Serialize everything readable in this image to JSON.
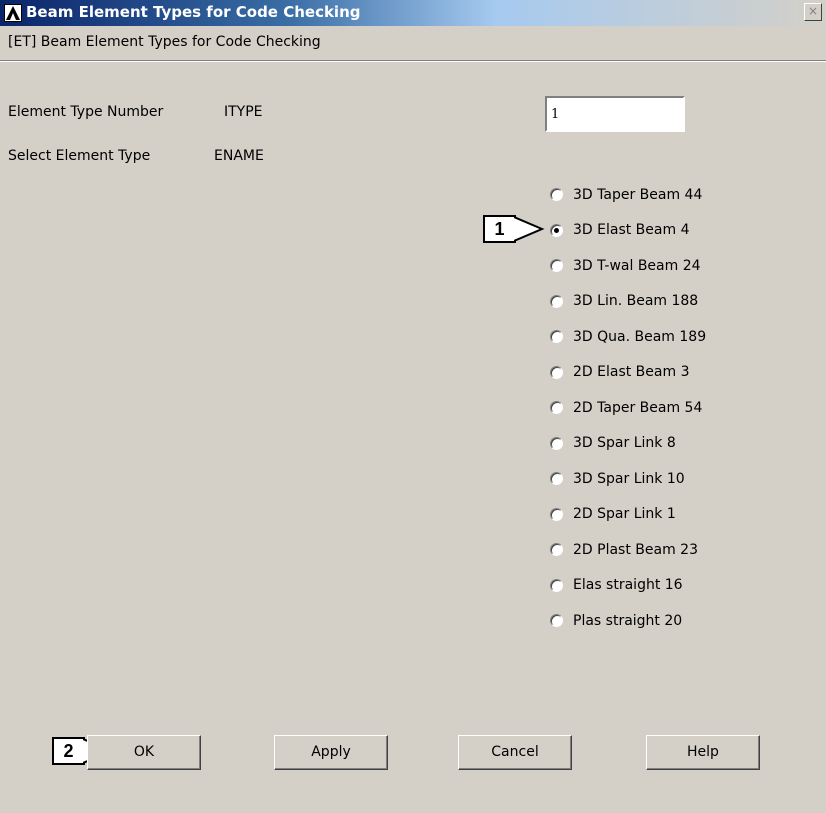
{
  "window": {
    "title": "Beam Element Types for Code Checking",
    "close_glyph": "×"
  },
  "header": {
    "text": "[ET] Beam Element Types for Code Checking"
  },
  "fields": {
    "itype": {
      "label": "Element Type Number",
      "param": "ITYPE",
      "value": "1"
    },
    "ename": {
      "label": "Select Element Type",
      "param": "ENAME"
    }
  },
  "element_types": [
    {
      "label": "3D Taper Beam 44",
      "selected": false
    },
    {
      "label": "3D Elast Beam  4",
      "selected": true
    },
    {
      "label": "3D T-wal Beam 24",
      "selected": false
    },
    {
      "label": "3D Lin. Beam 188",
      "selected": false
    },
    {
      "label": "3D Qua. Beam 189",
      "selected": false
    },
    {
      "label": "2D Elast Beam  3",
      "selected": false
    },
    {
      "label": "2D Taper Beam 54",
      "selected": false
    },
    {
      "label": "3D Spar  Link  8",
      "selected": false
    },
    {
      "label": "3D Spar  Link 10",
      "selected": false
    },
    {
      "label": "2D Spar  Link  1",
      "selected": false
    },
    {
      "label": "2D Plast Beam 23",
      "selected": false
    },
    {
      "label": "Elas straight 16",
      "selected": false
    },
    {
      "label": "Plas straight 20",
      "selected": false
    }
  ],
  "buttons": {
    "ok": "OK",
    "apply": "Apply",
    "cancel": "Cancel",
    "help": "Help"
  },
  "callouts": {
    "one": "1",
    "two": "2"
  }
}
